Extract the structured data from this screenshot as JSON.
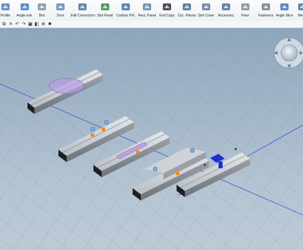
{
  "ribbon": {
    "items": [
      {
        "label": "Profile",
        "icon": "profile-icon"
      },
      {
        "label": "Angle extr.",
        "icon": "angle-extrusion-icon"
      },
      {
        "label": "Box",
        "icon": "box-icon"
      },
      {
        "label": "Door",
        "icon": "door-icon"
      },
      {
        "label": "Edit Connectors",
        "icon": "edit-connectors-icon"
      },
      {
        "label": "Slot Panel",
        "icon": "slot-panel-icon"
      },
      {
        "label": "Contour Pnl.",
        "icon": "contour-panel-icon"
      },
      {
        "label": "Rect. Panel",
        "icon": "rect-panel-icon"
      },
      {
        "label": "End Caps",
        "icon": "end-caps-icon"
      },
      {
        "label": "Circ. Pieces",
        "icon": "circ-pieces-icon"
      },
      {
        "label": "Slot Cover",
        "icon": "slot-cover-icon"
      },
      {
        "label": "Accessory",
        "icon": "accessory-icon"
      },
      {
        "label": "Floor",
        "icon": "floor-icon"
      },
      {
        "label": "Fasteners",
        "icon": "fasteners-icon"
      },
      {
        "label": "Angle Slice",
        "icon": "angle-slice-icon"
      },
      {
        "label": "Meas",
        "icon": "measure-icon"
      }
    ]
  },
  "quick_access": [
    {
      "icon": "copy-icon",
      "glyph": "⧉"
    },
    {
      "icon": "delete-icon",
      "glyph": "✕"
    },
    {
      "icon": "undo-icon",
      "glyph": "↶"
    },
    {
      "icon": "redo-icon",
      "glyph": "↷"
    },
    {
      "icon": "snapshot-icon",
      "glyph": "▣"
    },
    {
      "icon": "measure-tool-icon",
      "glyph": "◧"
    },
    {
      "icon": "zoom-icon",
      "glyph": "⊕"
    },
    {
      "icon": "settings-icon",
      "glyph": "✹"
    }
  ],
  "colors": {
    "accent_orange": "#f08a24",
    "highlight_purple": "#b79be6",
    "clamp_blue": "#1f2fd6",
    "profile_silver": "#c9ced3",
    "end_cap": "#1e1f22"
  }
}
